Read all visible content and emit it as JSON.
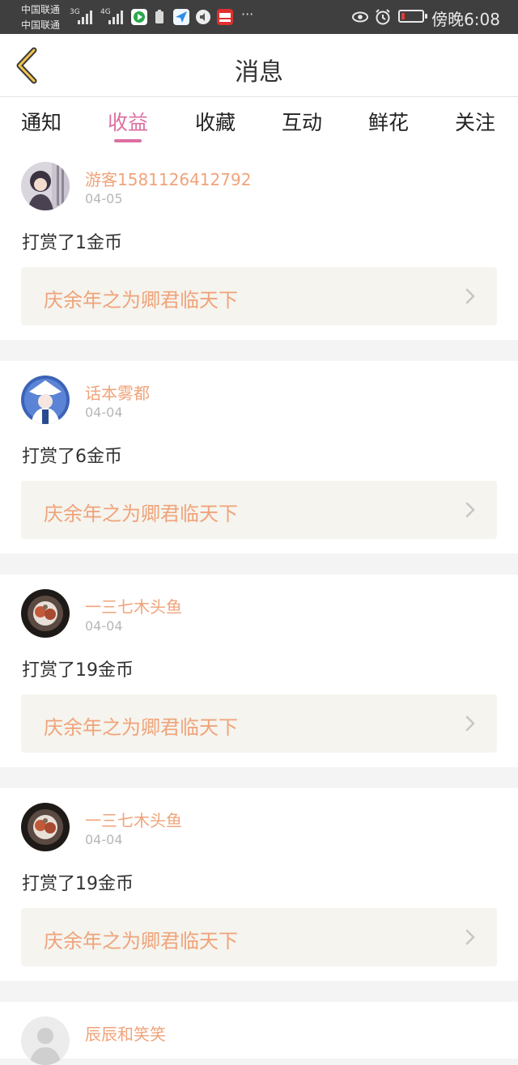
{
  "status_bar": {
    "carrier1": "中国联通",
    "carrier2": "中国联通",
    "net1": "3G",
    "net2": "4G",
    "more": "···",
    "time": "傍晚6:08",
    "battery_color": "#e23a3a"
  },
  "header": {
    "title": "消息",
    "back_icon": "chevron-left-icon"
  },
  "tabs": [
    {
      "label": "通知",
      "active": false
    },
    {
      "label": "收益",
      "active": true
    },
    {
      "label": "收藏",
      "active": false
    },
    {
      "label": "互动",
      "active": false
    },
    {
      "label": "鲜花",
      "active": false
    },
    {
      "label": "关注",
      "active": false
    }
  ],
  "messages": [
    {
      "user": "游客1581126412792",
      "date": "04-05",
      "action": "打赏了1金币",
      "book": "庆余年之为卿君临天下"
    },
    {
      "user": "话本雾都",
      "date": "04-04",
      "action": "打赏了6金币",
      "book": "庆余年之为卿君临天下"
    },
    {
      "user": "一三七木头鱼",
      "date": "04-04",
      "action": "打赏了19金币",
      "book": "庆余年之为卿君临天下"
    },
    {
      "user": "一三七木头鱼",
      "date": "04-04",
      "action": "打赏了19金币",
      "book": "庆余年之为卿君临天下"
    },
    {
      "user": "辰辰和笑笑"
    }
  ],
  "colors": {
    "accent": "#dc6fa2",
    "username": "#f0a37a",
    "book_bg": "#f5f4ee"
  }
}
